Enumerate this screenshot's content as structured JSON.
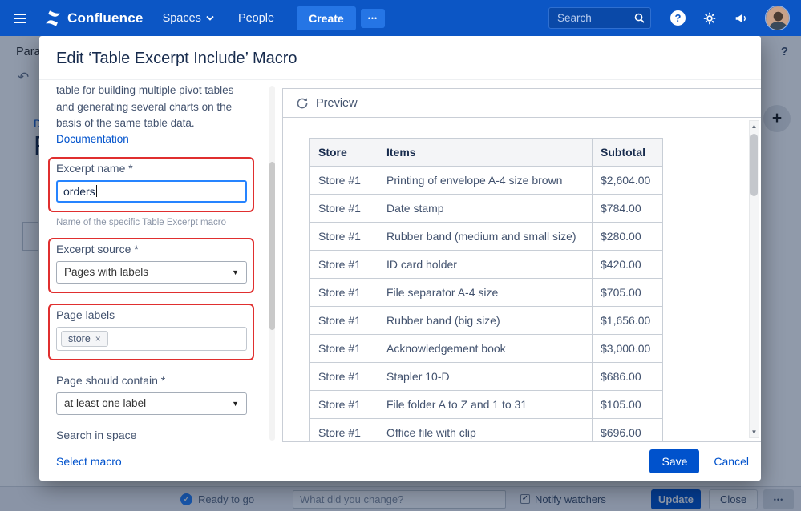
{
  "colors": {
    "navbar_bg": "#0C56C5",
    "navbar_button": "#2575E5",
    "accent_blue": "#0052CC",
    "focus_blue": "#2684FF",
    "highlight_red": "#E02F2F",
    "table_header_bg": "#F4F5F7"
  },
  "icons": {
    "dropdown_arrow": "▼",
    "scroll_up": "▲",
    "scroll_down": "▼",
    "undo": "↶",
    "chip_remove": "×",
    "check": "✓",
    "plus": "+",
    "question": "?"
  },
  "navbar": {
    "logo_text": "Confluence",
    "spaces_label": "Spaces",
    "people_label": "People",
    "create_label": "Create",
    "more_label": "•••",
    "search_placeholder": "Search"
  },
  "background": {
    "toolbar_fragment": "Para",
    "help_fragment": "?",
    "breadcrumb_fragment": "D",
    "page_title_fragment": "F",
    "bottom_bar": {
      "status_label": "Ready to go",
      "comment_placeholder": "What did you change?",
      "notify_watchers_label": "Notify watchers",
      "update_label": "Update",
      "close_label": "Close",
      "more_label": "•••"
    }
  },
  "modal": {
    "title": "Edit ‘Table Excerpt Include’ Macro",
    "form": {
      "description": "table for building multiple pivot tables and generating several charts on the basis of the same table data.",
      "documentation_label": "Documentation",
      "excerpt_name": {
        "label": "Excerpt name *",
        "value": "orders",
        "helper": "Name of the specific Table Excerpt macro"
      },
      "excerpt_source": {
        "label": "Excerpt source *",
        "value": "Pages with labels"
      },
      "page_labels": {
        "label": "Page labels",
        "tag": "store"
      },
      "page_should_contain": {
        "label": "Page should contain *",
        "value": "at least one label"
      },
      "search_in_space": {
        "label": "Search in space",
        "value": ""
      }
    },
    "preview": {
      "title": "Preview",
      "table": {
        "headers": [
          "Store",
          "Items",
          "Subtotal"
        ],
        "rows": [
          [
            "Store #1",
            "Printing of envelope A-4 size brown",
            "$2,604.00"
          ],
          [
            "Store #1",
            "Date stamp",
            "$784.00"
          ],
          [
            "Store #1",
            "Rubber band (medium and small size)",
            "$280.00"
          ],
          [
            "Store #1",
            "ID card holder",
            "$420.00"
          ],
          [
            "Store #1",
            "File separator A-4 size",
            "$705.00"
          ],
          [
            "Store #1",
            "Rubber band (big size)",
            "$1,656.00"
          ],
          [
            "Store #1",
            "Acknowledgement book",
            "$3,000.00"
          ],
          [
            "Store #1",
            "Stapler 10-D",
            "$686.00"
          ],
          [
            "Store #1",
            "File folder A to Z and 1 to 31",
            "$105.00"
          ],
          [
            "Store #1",
            "Office file with clip",
            "$696.00"
          ]
        ]
      }
    },
    "footer": {
      "select_macro_label": "Select macro",
      "save_label": "Save",
      "cancel_label": "Cancel"
    }
  }
}
